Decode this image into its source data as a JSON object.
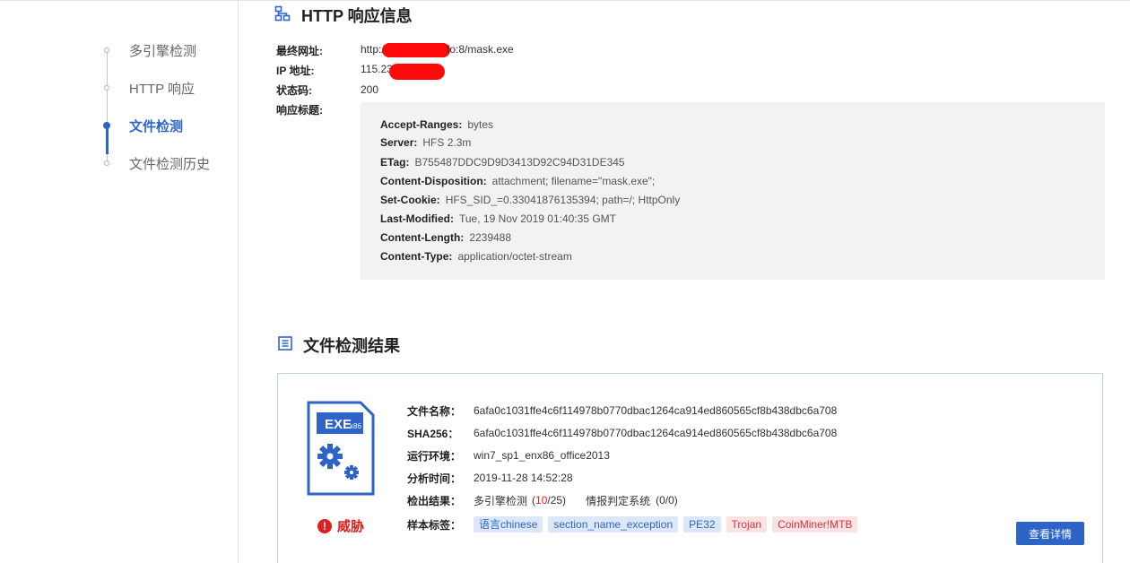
{
  "nav": {
    "items": [
      {
        "label": "多引擎检测",
        "active": false
      },
      {
        "label": "HTTP 响应",
        "active": false
      },
      {
        "label": "文件检测",
        "active": true
      },
      {
        "label": "文件检测历史",
        "active": false
      }
    ]
  },
  "http": {
    "title": "HTTP 响应信息",
    "final_url_label": "最终网址:",
    "final_url_prefix": "http://",
    "final_url_suffix": "fo:8/mask.exe",
    "ip_label": "IP 地址:",
    "ip_prefix": "115.23",
    "status_label": "状态码:",
    "status_value": "200",
    "headers_label": "响应标题:",
    "headers": [
      {
        "key": "Accept-Ranges:",
        "value": "bytes"
      },
      {
        "key": "Server:",
        "value": "HFS 2.3m"
      },
      {
        "key": "ETag:",
        "value": "B755487DDC9D9D3413D92C94D31DE345"
      },
      {
        "key": "Content-Disposition:",
        "value": "attachment; filename=\"mask.exe\";"
      },
      {
        "key": "Set-Cookie:",
        "value": "HFS_SID_=0.33041876135394; path=/; HttpOnly"
      },
      {
        "key": "Last-Modified:",
        "value": "Tue, 19 Nov 2019 01:40:35 GMT"
      },
      {
        "key": "Content-Length:",
        "value": "2239488"
      },
      {
        "key": "Content-Type:",
        "value": "application/octet-stream"
      }
    ]
  },
  "file": {
    "title": "文件检测结果",
    "icon_text": "EXE",
    "icon_sub": "x86",
    "threat_label": "威胁",
    "name_label": "文件名称：",
    "name_value": "6afa0c1031ffe4c6f114978b0770dbac1264ca914ed860565cf8b438dbc6a708",
    "sha_label": "SHA256：",
    "sha_value": "6afa0c1031ffe4c6f114978b0770dbac1264ca914ed860565cf8b438dbc6a708",
    "env_label": "运行环境：",
    "env_value": "win7_sp1_enx86_office2013",
    "time_label": "分析时间：",
    "time_value": "2019-11-28 14:52:28",
    "result_label": "检出结果：",
    "engine_label": "多引擎检测",
    "engine_open": "(",
    "engine_hits": "10",
    "engine_total": "/25)",
    "intel_label": "情报判定系统",
    "intel_value": "(0/0)",
    "tags_label": "样本标签：",
    "tags": [
      {
        "label": "语言chinese",
        "tone": "blue"
      },
      {
        "label": "section_name_exception",
        "tone": "blue"
      },
      {
        "label": "PE32",
        "tone": "blue"
      },
      {
        "label": "Trojan",
        "tone": "red"
      },
      {
        "label": "CoinMiner!MTB",
        "tone": "red"
      }
    ],
    "detail_button": "查看详情"
  },
  "colors": {
    "accent": "#2e64c8",
    "danger": "#e02020",
    "panel_bg": "#f2f2f2",
    "card_border": "#bcd2ec"
  }
}
